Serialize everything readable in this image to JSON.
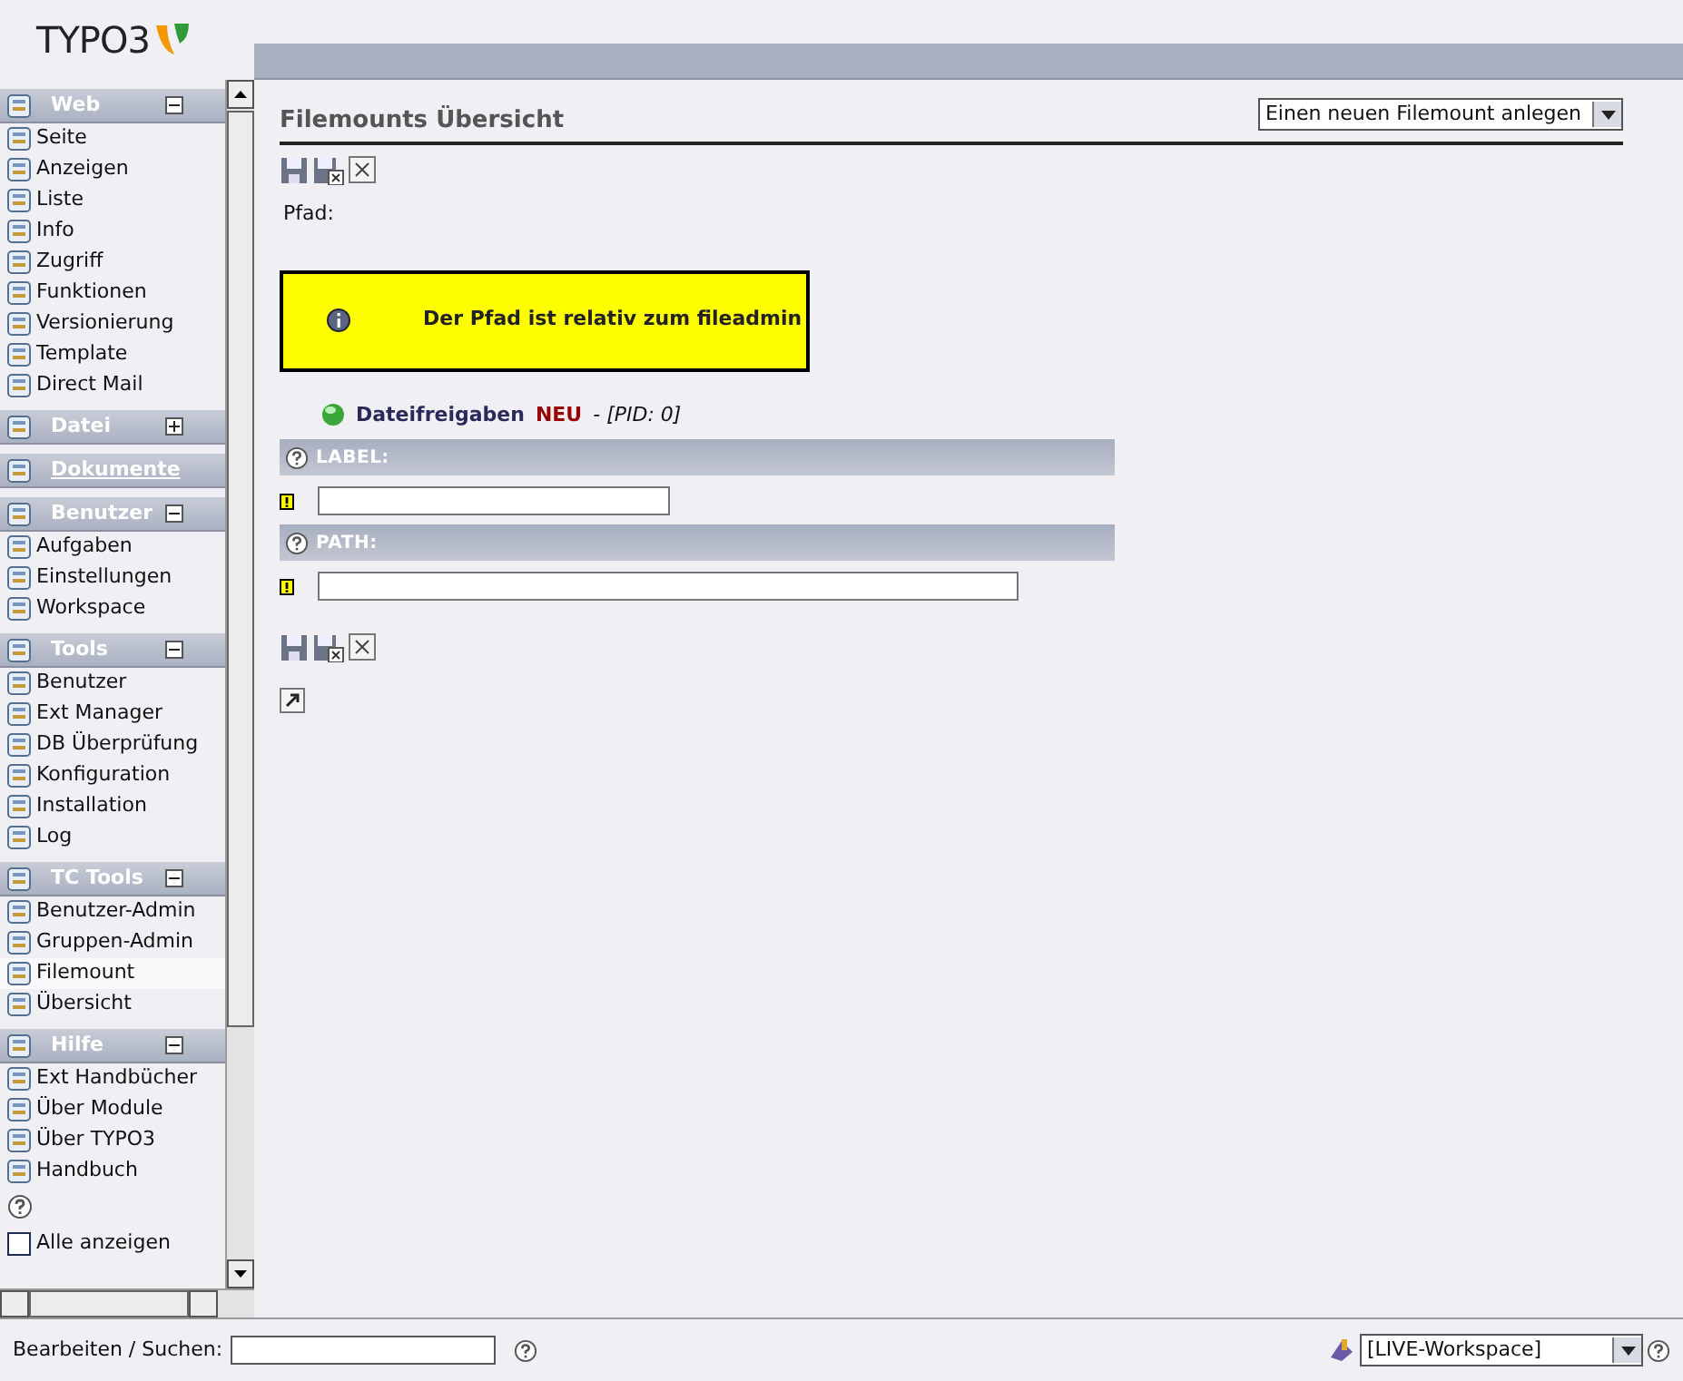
{
  "logo": {
    "text": "TYPO3"
  },
  "sidebar": {
    "groups": [
      {
        "kind": "group",
        "title": "Web",
        "expanded": true,
        "items": [
          {
            "label": "Seite",
            "selected": false
          },
          {
            "label": "Anzeigen",
            "selected": false
          },
          {
            "label": "Liste",
            "selected": false
          },
          {
            "label": "Info",
            "selected": false
          },
          {
            "label": "Zugriff",
            "selected": false
          },
          {
            "label": "Funktionen",
            "selected": false
          },
          {
            "label": "Versionierung",
            "selected": false
          },
          {
            "label": "Template",
            "selected": false
          },
          {
            "label": "Direct Mail",
            "selected": false
          }
        ]
      },
      {
        "kind": "group",
        "title": "Datei",
        "expanded": false
      },
      {
        "kind": "link",
        "title": "Dokumente"
      },
      {
        "kind": "group",
        "title": "Benutzer",
        "expanded": true,
        "items": [
          {
            "label": "Aufgaben",
            "selected": false
          },
          {
            "label": "Einstellungen",
            "selected": false
          },
          {
            "label": "Workspace",
            "selected": false
          }
        ]
      },
      {
        "kind": "group",
        "title": "Tools",
        "expanded": true,
        "items": [
          {
            "label": "Benutzer",
            "selected": false
          },
          {
            "label": "Ext Manager",
            "selected": false
          },
          {
            "label": "DB Überprüfung",
            "selected": false
          },
          {
            "label": "Konfiguration",
            "selected": false
          },
          {
            "label": "Installation",
            "selected": false
          },
          {
            "label": "Log",
            "selected": false
          }
        ]
      },
      {
        "kind": "group",
        "title": "TC Tools",
        "expanded": true,
        "items": [
          {
            "label": "Benutzer-Admin",
            "selected": false
          },
          {
            "label": "Gruppen-Admin",
            "selected": false
          },
          {
            "label": "Filemount",
            "selected": true
          },
          {
            "label": "Übersicht",
            "selected": false
          }
        ]
      },
      {
        "kind": "group",
        "title": "Hilfe",
        "expanded": true,
        "items": [
          {
            "label": "Ext Handbücher",
            "selected": false
          },
          {
            "label": "Über Module",
            "selected": false
          },
          {
            "label": "Über TYPO3",
            "selected": false
          },
          {
            "label": "Handbuch",
            "selected": false
          }
        ]
      }
    ],
    "show_all": {
      "label": "Alle anzeigen",
      "checked": false
    }
  },
  "main": {
    "title": "Filemounts Übersicht",
    "new_select": "Einen neuen Filemount anlegen",
    "path_label": "Pfad:",
    "info": "Der Pfad ist relativ zum fileadmin",
    "record": {
      "title": "Dateifreigaben",
      "status": "NEU",
      "pid": "- [PID: 0]"
    },
    "fields": [
      {
        "label": "LABEL:"
      },
      {
        "label": "PATH:"
      }
    ]
  },
  "status_bar": {
    "search_label": "Bearbeiten / Suchen:",
    "workspace": "[LIVE-Workspace]"
  }
}
